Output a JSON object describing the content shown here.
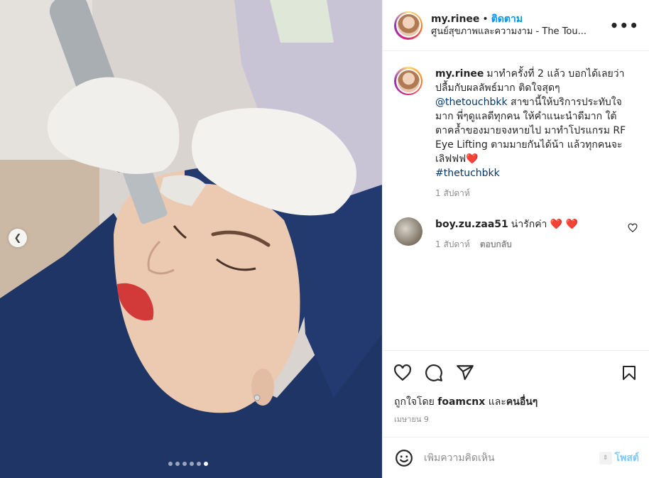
{
  "post": {
    "username": "my.rinee",
    "follow_label": "ติดตาม",
    "location": "ศูนย์สุขภาพและความงาม - The Tou...",
    "more_label": "•••"
  },
  "caption": {
    "username": "my.rinee",
    "text_part1": "มาทำครั้งที่ 2 แล้ว บอกได้เลยว่าปลื้มกับผลลัพธ์มาก ติดใจสุดๆ",
    "mention": "@thetouchbkk",
    "text_part2": "สาขานี้ให้บริการประทับใจมาก พี่ๆดูแลดีทุกคน ให้คำแนะนำดีมาก ใต้ตาคล้ำของมายจงหายไป มาทำโปรแกรม RF Eye Lifting ตามมายกันได้น้า แล้วทุกคนจะเลิฟฟฟ",
    "heart": "❤️",
    "hashtag": "#thetuchbkk",
    "time": "1 สัปดาห์"
  },
  "comment": {
    "username": "boy.zu.zaa51",
    "text": "น่ารักค่า",
    "hearts": "❤️ ❤️",
    "time": "1 สัปดาห์",
    "reply_label": "ตอบกลับ"
  },
  "likes": {
    "prefix": "ถูกใจโดย",
    "user": "foamcnx",
    "middle": "และ",
    "others": "คนอื่นๆ"
  },
  "date": "เมษายน 9",
  "composer": {
    "placeholder": "เพิ่มความคิดเห็น",
    "post_label": "โพสต์"
  },
  "carousel": {
    "count": 6,
    "active_index": 5
  },
  "colors": {
    "link": "#0095f6",
    "mention": "#00376b",
    "muted": "#8e8e8e"
  }
}
